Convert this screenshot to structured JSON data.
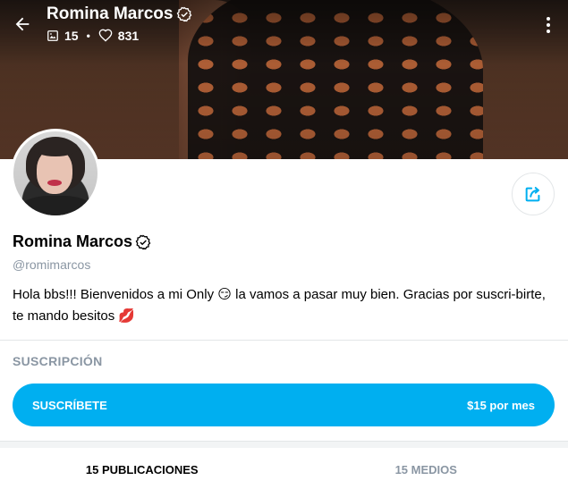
{
  "header": {
    "title": "Romina Marcos",
    "stats": {
      "media_count": "15",
      "likes_count": "831"
    },
    "icons": {
      "back": "back-arrow-icon",
      "verified": "verified-badge-icon",
      "media": "image-icon",
      "likes": "heart-icon",
      "more": "more-vertical-icon"
    }
  },
  "profile": {
    "name": "Romina Marcos",
    "handle": "@romimarcos",
    "bio_part1": "Hola bbs!!! Bienvenidos a mi Only",
    "bio_emoji1": "😏",
    "bio_part2": "la vamos a pasar muy bien. Gracias por suscri-birte, te mando besitos",
    "bio_emoji2": "💋",
    "share_icon": "share-icon"
  },
  "subscription": {
    "heading": "SUSCRIPCIÓN",
    "button_label": "SUSCRÍBETE",
    "price": "$15 por mes"
  },
  "tabs": [
    {
      "label": "15 PUBLICACIONES",
      "active": true
    },
    {
      "label": "15 MEDIOS",
      "active": false
    }
  ],
  "colors": {
    "accent": "#00aff0",
    "muted": "#8a96a3",
    "divider": "#e3e6e8"
  }
}
